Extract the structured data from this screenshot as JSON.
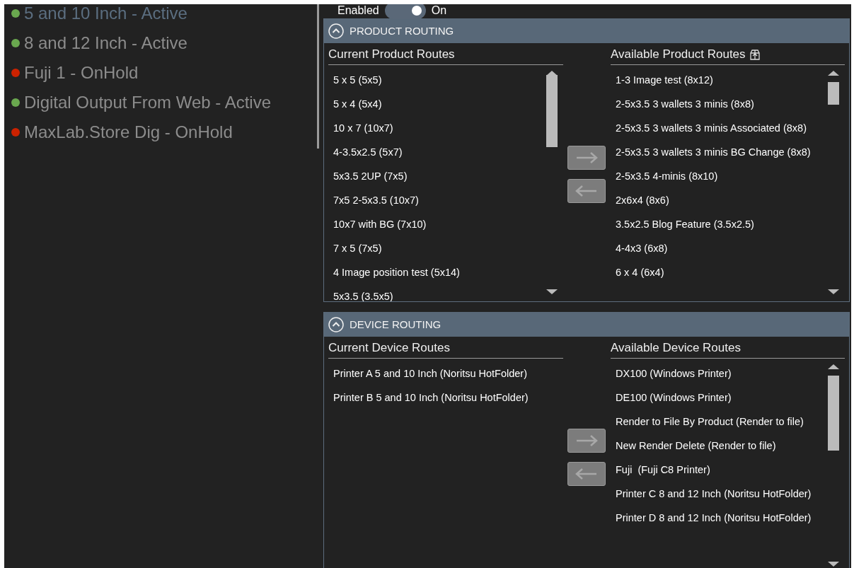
{
  "sidebar": {
    "items": [
      {
        "label": "5 and 10 Inch - Active",
        "color": "#6aa84f",
        "selected": true
      },
      {
        "label": "8 and 12 Inch - Active",
        "color": "#6aa84f",
        "selected": false
      },
      {
        "label": "Fuji 1 - OnHold",
        "color": "#cc2200",
        "selected": false
      },
      {
        "label": "Digital Output From Web - Active",
        "color": "#6aa84f",
        "selected": false
      },
      {
        "label": "MaxLab.Store Dig - OnHold",
        "color": "#cc2200",
        "selected": false
      }
    ]
  },
  "enabled": {
    "label": "Enabled",
    "on": true,
    "state_text": "On"
  },
  "sections": [
    {
      "title": "PRODUCT ROUTING",
      "expanded": true,
      "current": {
        "heading": "Current Product Routes",
        "items": [
          "5 x 5 (5x5)",
          "5 x 4 (5x4)",
          "10 x 7 (10x7)",
          "4-3.5x2.5 (5x7)",
          "5x3.5 2UP (7x5)",
          "7x5 2-5x3.5 (10x7)",
          "10x7 with BG (7x10)",
          "7 x 5 (7x5)",
          "4 Image position test (5x14)",
          "5x3.5 (3.5x5)"
        ]
      },
      "available": {
        "heading": "Available Product Routes",
        "heading_icon": true,
        "items": [
          "1-3 Image test (8x12)",
          "2-5x3.5 3 wallets 3 minis (8x8)",
          "2-5x3.5 3 wallets 3 minis Associated (8x8)",
          "2-5x3.5 3 wallets 3 minis BG Change (8x8)",
          "2-5x3.5 4-minis (8x10)",
          "2x6x4 (8x6)",
          "3.5x2.5 Blog Feature (3.5x2.5)",
          "4-4x3 (6x8)",
          "6 x 4 (6x4)"
        ]
      }
    },
    {
      "title": "DEVICE ROUTING",
      "expanded": true,
      "current": {
        "heading": "Current Device Routes",
        "items": [
          "Printer A 5 and 10 Inch (Noritsu HotFolder)",
          "Printer B 5 and 10 Inch (Noritsu HotFolder)"
        ]
      },
      "available": {
        "heading": "Available Device Routes",
        "items": [
          "DX100 (Windows Printer)",
          "DE100 (Windows Printer)",
          "Render to File By Product (Render to file)",
          "New Render Delete (Render to file)",
          "Fuji  (Fuji C8 Printer)",
          "Printer C 8 and 12 Inch (Noritsu HotFolder)",
          "Printer D 8 and 12 Inch (Noritsu HotFolder)"
        ]
      }
    }
  ]
}
